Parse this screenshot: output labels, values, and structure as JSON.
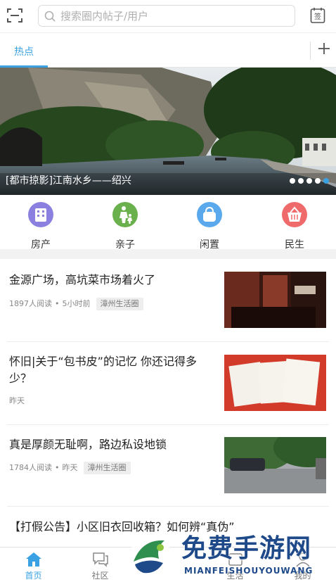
{
  "header": {
    "scan_icon": "scan-icon",
    "search_placeholder": "搜索圈内帖子/用户",
    "sign_icon": "sign-in-icon",
    "sign_label": "签"
  },
  "tabs": {
    "items": [
      {
        "label": "热点",
        "active": true
      }
    ],
    "add_icon": "plus-icon"
  },
  "banner": {
    "caption": "[都市掠影]江南水乡——绍兴",
    "dot_count": 5,
    "active_dot": 4
  },
  "categories": [
    {
      "label": "房产",
      "icon": "building-icon",
      "color": "#8b80e0"
    },
    {
      "label": "亲子",
      "icon": "family-icon",
      "color": "#6ab04c"
    },
    {
      "label": "闲置",
      "icon": "bag-icon",
      "color": "#5aa9ec"
    },
    {
      "label": "民生",
      "icon": "basket-icon",
      "color": "#ef6a6a"
    }
  ],
  "feed": [
    {
      "title": "金源广场，高坑菜市场着火了",
      "reads": "1897人阅读",
      "time": "5小时前",
      "group": "漳州生活圈"
    },
    {
      "title": "怀旧|关于“包书皮”的记忆 你还记得多少？",
      "reads": "",
      "time": "昨天",
      "group": ""
    },
    {
      "title": "真是厚颜无耻啊，路边私设地锁",
      "reads": "1784人阅读",
      "time": "昨天",
      "group": "漳州生活圈"
    },
    {
      "title": "【打假公告】小区旧衣回收箱？如何辨“真伪”",
      "reads": "",
      "time": "",
      "group": ""
    }
  ],
  "bottom_nav": [
    {
      "label": "首页",
      "icon": "home-icon",
      "active": true
    },
    {
      "label": "社区",
      "icon": "chat-icon",
      "active": false
    },
    {
      "label": "",
      "icon": "center-icon",
      "active": false
    },
    {
      "label": "生活",
      "icon": "life-icon",
      "active": false
    },
    {
      "label": "我的",
      "icon": "user-icon",
      "active": false
    }
  ],
  "watermark": {
    "title": "免费手游网",
    "subtitle": "MIANFEISHOUYOUWANG"
  },
  "colors": {
    "accent": "#3aa2e3",
    "badge_bg": "#eeeeee",
    "divider": "#f2f2f2"
  }
}
